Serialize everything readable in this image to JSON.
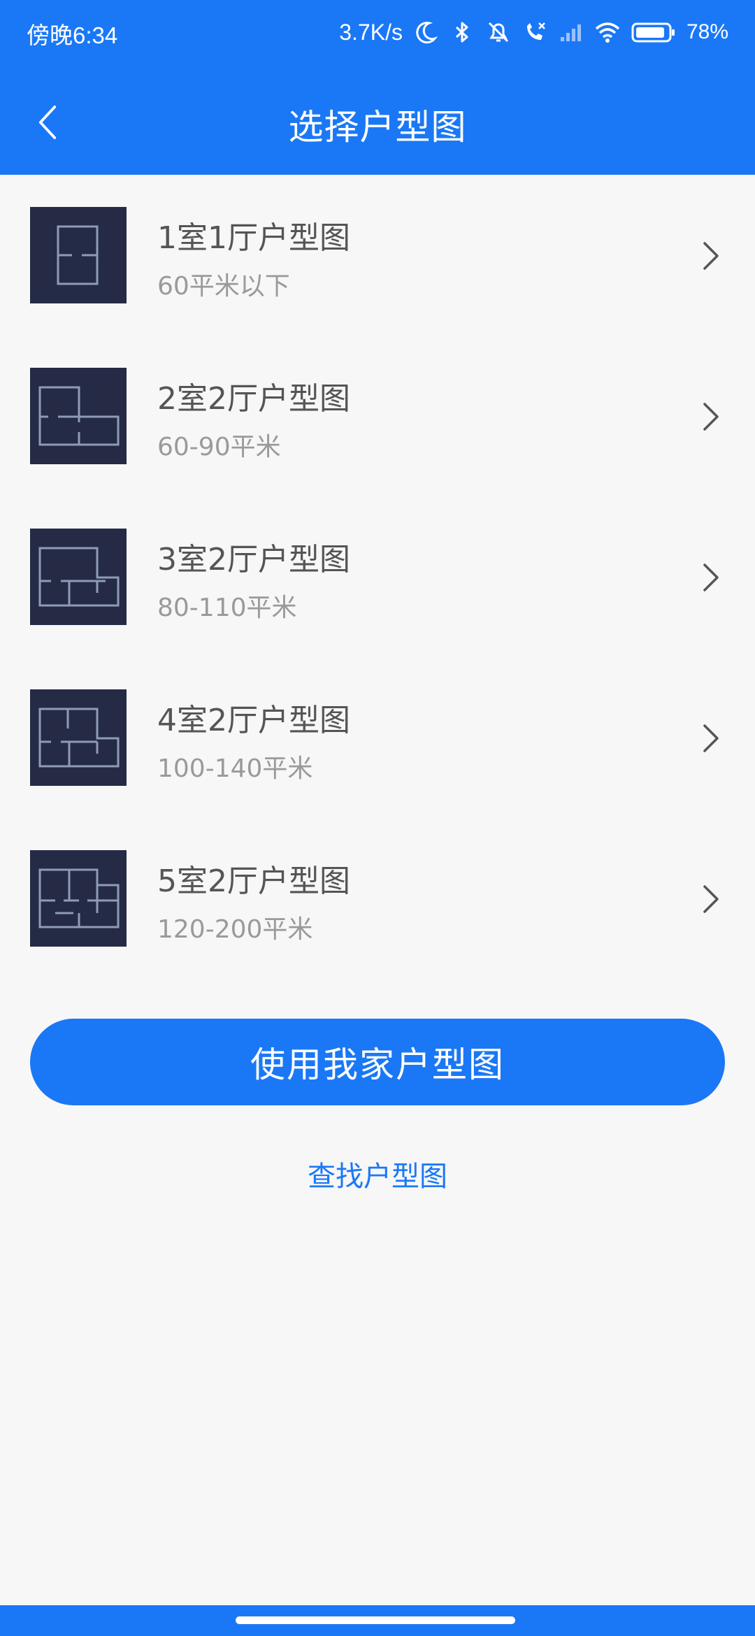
{
  "status_bar": {
    "time": "傍晚6:34",
    "net_speed": "3.7K/s",
    "battery": "78%",
    "icons": [
      "moon-icon",
      "bluetooth-icon",
      "mute-bell-icon",
      "call-icon",
      "signal-icon",
      "wifi-icon",
      "battery-icon"
    ]
  },
  "nav": {
    "back_icon": "chevron-left-icon",
    "title": "选择户型图"
  },
  "list": {
    "items": [
      {
        "title": "1室1厅户型图",
        "subtitle": "60平米以下"
      },
      {
        "title": "2室2厅户型图",
        "subtitle": "60-90平米"
      },
      {
        "title": "3室2厅户型图",
        "subtitle": "80-110平米"
      },
      {
        "title": "4室2厅户型图",
        "subtitle": "100-140平米"
      },
      {
        "title": "5室2厅户型图",
        "subtitle": "120-200平米"
      }
    ]
  },
  "actions": {
    "primary_label": "使用我家户型图",
    "link_label": "查找户型图"
  },
  "colors": {
    "accent": "#1a78f6",
    "thumb_bg": "#252b45",
    "thumb_line": "#8f9bb6",
    "background": "#f7f7f7"
  }
}
